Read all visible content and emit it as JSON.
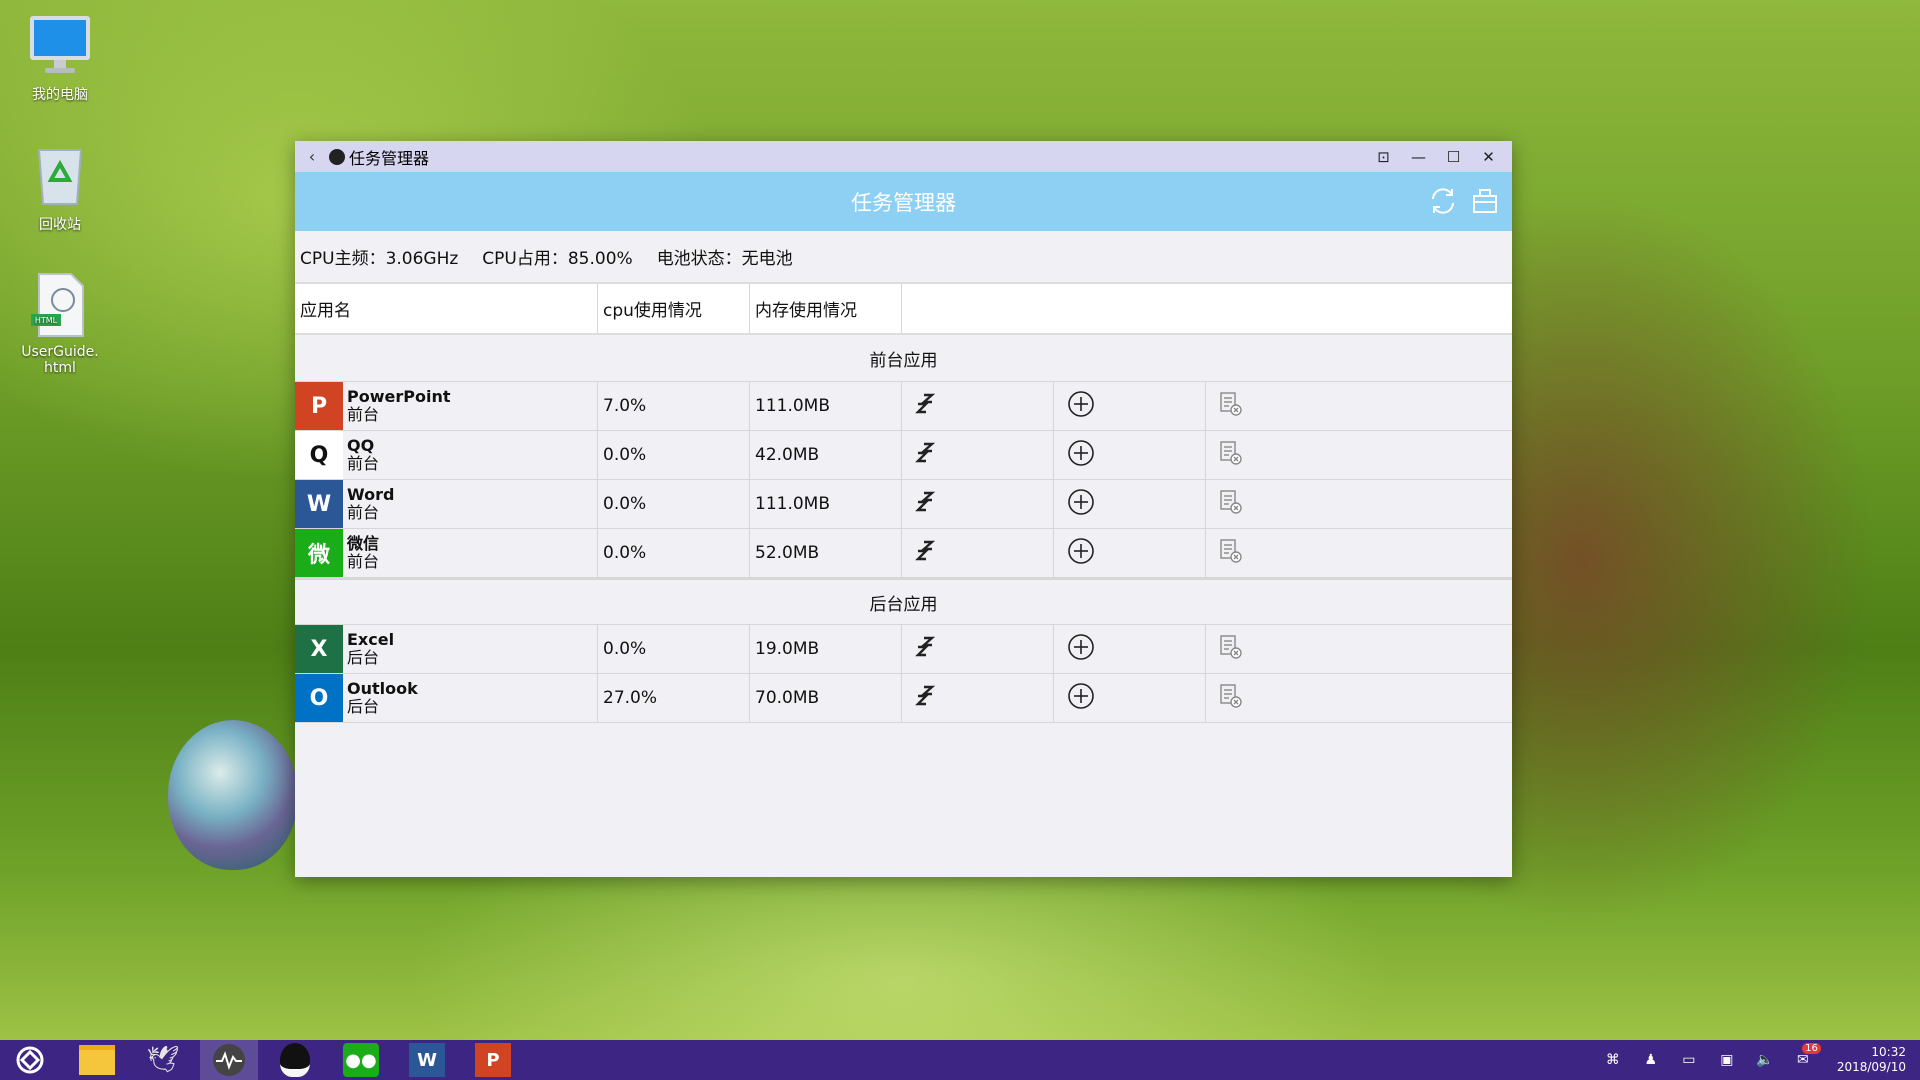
{
  "desktop": {
    "icons": [
      {
        "label": "我的电脑"
      },
      {
        "label": "回收站"
      },
      {
        "label": "UserGuide.html"
      }
    ]
  },
  "window": {
    "titlebar": {
      "title": "任务管理器",
      "back_icon": "chevron-left-icon"
    },
    "header": {
      "title": "任务管理器"
    },
    "info": {
      "cpu_freq": "CPU主频：3.06GHz",
      "cpu_usage": "CPU占用：85.00%",
      "battery": "电池状态：无电池"
    },
    "columns": {
      "name": "应用名",
      "cpu": "cpu使用情况",
      "mem": "内存使用情况"
    },
    "sections": {
      "foreground": "前台应用",
      "background": "后台应用"
    },
    "foreground_apps": [
      {
        "name": "PowerPoint",
        "state": "前台",
        "cpu": "7.0%",
        "mem": "111.0MB",
        "color": "#d04423",
        "letter": "P"
      },
      {
        "name": "QQ",
        "state": "前台",
        "cpu": "0.0%",
        "mem": "42.0MB",
        "color": "#ffffff",
        "letter": "Q"
      },
      {
        "name": "Word",
        "state": "前台",
        "cpu": "0.0%",
        "mem": "111.0MB",
        "color": "#2b5797",
        "letter": "W"
      },
      {
        "name": "微信",
        "state": "前台",
        "cpu": "0.0%",
        "mem": "52.0MB",
        "color": "#1aad19",
        "letter": "微"
      }
    ],
    "background_apps": [
      {
        "name": "Excel",
        "state": "后台",
        "cpu": "0.0%",
        "mem": "19.0MB",
        "color": "#1e7145",
        "letter": "X"
      },
      {
        "name": "Outlook",
        "state": "后台",
        "cpu": "27.0%",
        "mem": "70.0MB",
        "color": "#0072c6",
        "letter": "O"
      }
    ]
  },
  "taskbar": {
    "clock_time": "10:32",
    "clock_date": "2018/09/10",
    "notification_count": "16"
  }
}
